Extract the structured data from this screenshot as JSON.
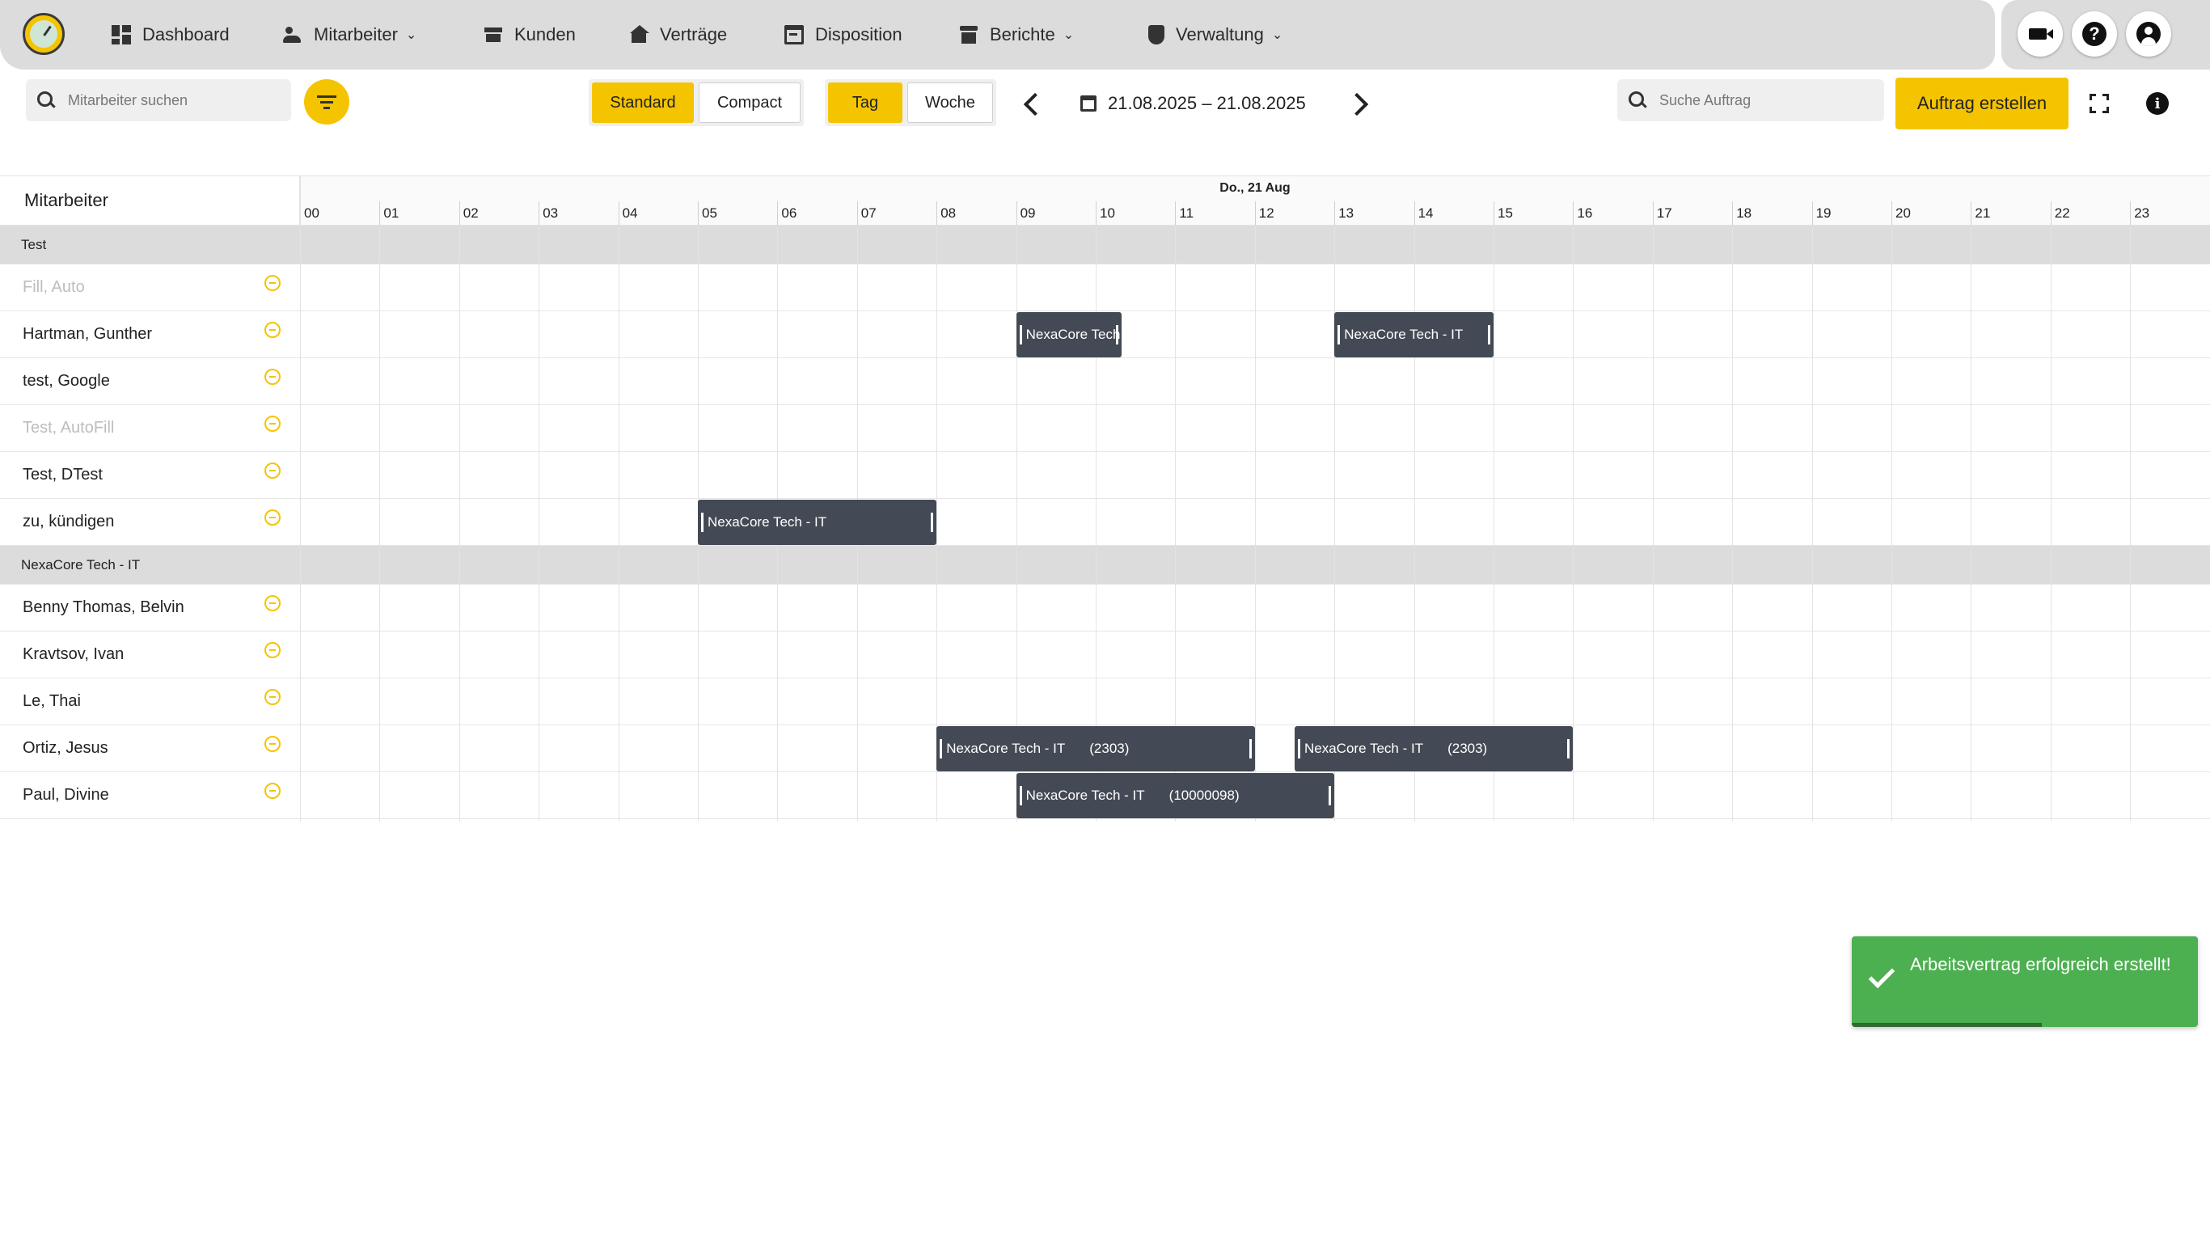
{
  "nav": {
    "items": [
      {
        "label": "Dashboard",
        "icon": "dashboard-icon",
        "has_dropdown": false
      },
      {
        "label": "Mitarbeiter",
        "icon": "people-icon",
        "has_dropdown": true
      },
      {
        "label": "Kunden",
        "icon": "store-icon",
        "has_dropdown": false
      },
      {
        "label": "Verträge",
        "icon": "house-icon",
        "has_dropdown": false
      },
      {
        "label": "Disposition",
        "icon": "calendar-icon",
        "has_dropdown": false
      },
      {
        "label": "Berichte",
        "icon": "archive-icon",
        "has_dropdown": true
      },
      {
        "label": "Verwaltung",
        "icon": "shield-icon",
        "has_dropdown": true
      }
    ],
    "right_icons": [
      "video-camera-icon",
      "help-icon",
      "account-icon"
    ]
  },
  "toolbar": {
    "employee_search_placeholder": "Mitarbeiter suchen",
    "view_modes": [
      {
        "label": "Standard",
        "active": true
      },
      {
        "label": "Compact",
        "active": false
      }
    ],
    "range_modes": [
      {
        "label": "Tag",
        "active": true
      },
      {
        "label": "Woche",
        "active": false
      }
    ],
    "date_range": "21.08.2025 – 21.08.2025",
    "order_search_placeholder": "Suche Auftrag",
    "create_order_label": "Auftrag erstellen"
  },
  "scheduler": {
    "resource_header": "Mitarbeiter",
    "day_label": "Do., 21 Aug",
    "hours": [
      "00",
      "01",
      "02",
      "03",
      "04",
      "05",
      "06",
      "07",
      "08",
      "09",
      "10",
      "11",
      "12",
      "13",
      "14",
      "15",
      "16",
      "17",
      "18",
      "19",
      "20",
      "21",
      "22",
      "23"
    ],
    "rows": [
      {
        "type": "group",
        "label": "Test"
      },
      {
        "type": "resource",
        "label": "Fill, Auto",
        "faded": true
      },
      {
        "type": "resource",
        "label": "Hartman, Gunther",
        "faded": false
      },
      {
        "type": "resource",
        "label": "test, Google",
        "faded": false
      },
      {
        "type": "resource",
        "label": "Test, AutoFill",
        "faded": true
      },
      {
        "type": "resource",
        "label": "Test, DTest",
        "faded": false
      },
      {
        "type": "resource",
        "label": "zu, kündigen",
        "faded": false
      },
      {
        "type": "group",
        "label": "NexaCore Tech - IT"
      },
      {
        "type": "resource",
        "label": "Benny Thomas, Belvin",
        "faded": false
      },
      {
        "type": "resource",
        "label": "Kravtsov, Ivan",
        "faded": false
      },
      {
        "type": "resource",
        "label": "Le, Thai",
        "faded": false
      },
      {
        "type": "resource",
        "label": "Ortiz, Jesus",
        "faded": false
      },
      {
        "type": "resource",
        "label": "Paul, Divine",
        "faded": false
      }
    ],
    "events": [
      {
        "row": 2,
        "start": 9.0,
        "end": 10.33,
        "label": "NexaCore Tech",
        "number": ""
      },
      {
        "row": 2,
        "start": 13.0,
        "end": 15.0,
        "label": "NexaCore Tech - IT",
        "number": ""
      },
      {
        "row": 6,
        "start": 5.0,
        "end": 8.0,
        "label": "NexaCore Tech - IT",
        "number": ""
      },
      {
        "row": 11,
        "start": 8.0,
        "end": 12.0,
        "label": "NexaCore Tech - IT",
        "number": "(2303)"
      },
      {
        "row": 11,
        "start": 12.5,
        "end": 16.0,
        "label": "NexaCore Tech - IT",
        "number": "(2303)"
      },
      {
        "row": 12,
        "start": 9.0,
        "end": 13.0,
        "label": "NexaCore Tech - IT",
        "number": "(10000098)"
      }
    ]
  },
  "toast": {
    "message": "Arbeitsvertrag erfolgreich erstellt!",
    "progress": 0.55,
    "color": "#4caf50"
  },
  "colors": {
    "accent": "#f5c400",
    "event": "#434a55",
    "group_row": "#dcdcdc"
  }
}
